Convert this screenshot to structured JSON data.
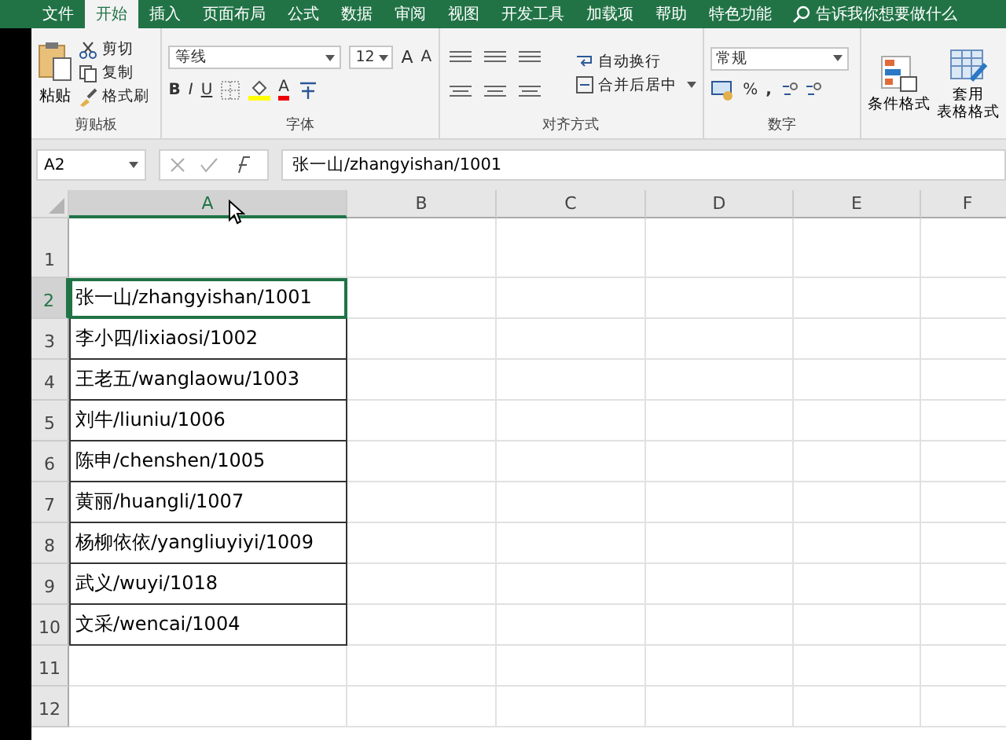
{
  "tabs": [
    {
      "label": "文件",
      "selected": false
    },
    {
      "label": "开始",
      "selected": true
    },
    {
      "label": "插入",
      "selected": false
    },
    {
      "label": "页面布局",
      "selected": false
    },
    {
      "label": "公式",
      "selected": false
    },
    {
      "label": "数据",
      "selected": false
    },
    {
      "label": "审阅",
      "selected": false
    },
    {
      "label": "视图",
      "selected": false
    },
    {
      "label": "开发工具",
      "selected": false
    },
    {
      "label": "加载项",
      "selected": false
    },
    {
      "label": "帮助",
      "selected": false
    },
    {
      "label": "特色功能",
      "selected": false
    }
  ],
  "search": {
    "placeholder": "告诉我你想要做什么"
  },
  "clipboard": {
    "paste": "粘贴",
    "cut": "剪切",
    "copy": "复制",
    "format_painter": "格式刷",
    "label": "剪贴板"
  },
  "font": {
    "name": "等线",
    "size": "12",
    "grow": "A",
    "shrink": "A",
    "bold": "B",
    "italic": "I",
    "underline": "U",
    "font_color": "A",
    "label": "字体"
  },
  "alignment": {
    "wrap": "自动换行",
    "merge": "合并后居中",
    "label": "对齐方式"
  },
  "number": {
    "format": "常规",
    "percent": "%",
    "comma": ",",
    "label": "数字"
  },
  "styles": {
    "conditional": "条件格式",
    "table_lines": [
      "套用",
      "表格格式"
    ]
  },
  "name_box": "A2",
  "formula": "张一山/zhangyishan/1001",
  "columns": [
    {
      "label": "A",
      "selected": true
    },
    {
      "label": "B",
      "selected": false
    },
    {
      "label": "C",
      "selected": false
    },
    {
      "label": "D",
      "selected": false
    },
    {
      "label": "E",
      "selected": false
    },
    {
      "label": "F",
      "selected": false
    }
  ],
  "rows": [
    {
      "label": "1",
      "selected": false,
      "bordered": false,
      "cell": ""
    },
    {
      "label": "2",
      "selected": true,
      "bordered": true,
      "cell": "张一山/zhangyishan/1001"
    },
    {
      "label": "3",
      "selected": false,
      "bordered": true,
      "cell": "李小四/lixiaosi/1002"
    },
    {
      "label": "4",
      "selected": false,
      "bordered": true,
      "cell": "王老五/wanglaowu/1003"
    },
    {
      "label": "5",
      "selected": false,
      "bordered": true,
      "cell": "刘牛/liuniu/1006"
    },
    {
      "label": "6",
      "selected": false,
      "bordered": true,
      "cell": "陈申/chenshen/1005"
    },
    {
      "label": "7",
      "selected": false,
      "bordered": true,
      "cell": "黄丽/huangli/1007"
    },
    {
      "label": "8",
      "selected": false,
      "bordered": true,
      "cell": "杨柳依依/yangliuyiyi/1009"
    },
    {
      "label": "9",
      "selected": false,
      "bordered": true,
      "cell": "武义/wuyi/1018"
    },
    {
      "label": "10",
      "selected": false,
      "bordered": true,
      "cell": "文采/wencai/1004"
    },
    {
      "label": "11",
      "selected": false,
      "bordered": false,
      "cell": ""
    },
    {
      "label": "12",
      "selected": false,
      "bordered": false,
      "cell": ""
    }
  ]
}
